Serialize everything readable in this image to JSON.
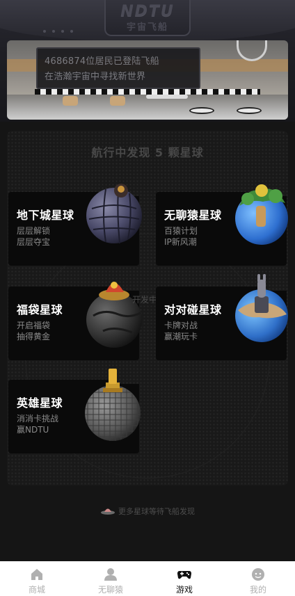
{
  "header": {
    "logo_text": "NDTU",
    "logo_subtitle": "宇宙飞船",
    "screen_line1": "4686874位居民已登陆飞船",
    "screen_line2": "在浩瀚宇宙中寻找新世界"
  },
  "panel": {
    "title": "航行中发现 5 颗星球",
    "dev_tag": "开发中",
    "more_text": "更多星球等待飞船发现"
  },
  "planets": [
    {
      "title": "地下城星球",
      "line1": "层层解锁",
      "line2": "层层夺宝",
      "icon": "grid-planet-icon"
    },
    {
      "title": "无聊猿星球",
      "line1": "百猿计划",
      "line2": "IP新风潮",
      "icon": "forest-planet-icon"
    },
    {
      "title": "福袋星球",
      "line1": "开启福袋",
      "line2": "抽得黄金",
      "icon": "lucky-bag-planet-icon"
    },
    {
      "title": "对对碰星球",
      "line1": "卡牌对战",
      "line2": "赢潮玩卡",
      "icon": "rabbit-planet-icon"
    },
    {
      "title": "英雄星球",
      "line1": "消消卡挑战",
      "line2": "赢NDTU",
      "icon": "voxel-planet-icon"
    }
  ],
  "tabbar": {
    "items": [
      {
        "label": "商城",
        "icon": "home-icon",
        "active": false
      },
      {
        "label": "无聊猿",
        "icon": "person-icon",
        "active": false
      },
      {
        "label": "游戏",
        "icon": "gamepad-icon",
        "active": true
      },
      {
        "label": "我的",
        "icon": "face-icon",
        "active": false
      }
    ]
  },
  "colors": {
    "background": "#151515",
    "card": "#0a0a0a",
    "tabbar": "#ffffff",
    "active_tab": "#111111",
    "inactive_tab": "#b0b0b0"
  }
}
